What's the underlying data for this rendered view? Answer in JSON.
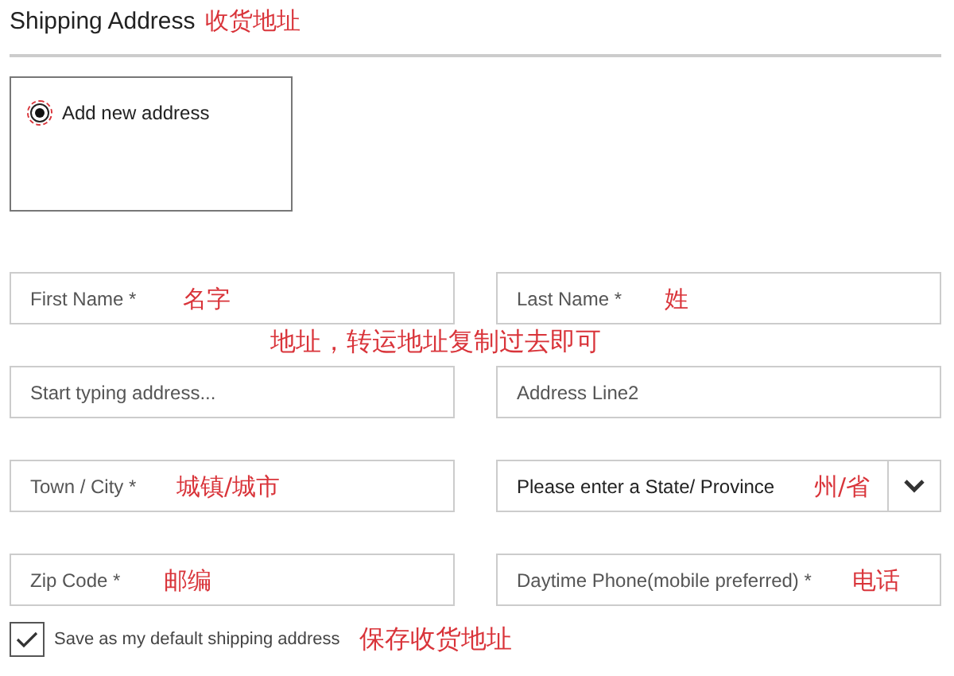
{
  "title": "Shipping Address",
  "title_note": "收货地址",
  "address_option": {
    "label": "Add new address",
    "selected": true
  },
  "fields": [
    {
      "kind": "input",
      "placeholder": "First Name *",
      "note": "名字"
    },
    {
      "kind": "input",
      "placeholder": "Last Name *",
      "note": "姓"
    },
    {
      "kind": "input",
      "placeholder": "Start typing address..."
    },
    {
      "kind": "input",
      "placeholder": "Address Line2"
    },
    {
      "kind": "input",
      "placeholder": "Town / City *",
      "note": "城镇/城市"
    },
    {
      "kind": "select",
      "value": "Please enter a State/ Province",
      "note": "州/省"
    },
    {
      "kind": "input",
      "placeholder": "Zip Code *",
      "note": "邮编"
    },
    {
      "kind": "input",
      "placeholder": "Daytime Phone(mobile preferred) *",
      "note": "电话"
    }
  ],
  "address_note": "地址，转运地址复制过去即可",
  "save_default": {
    "label": "Save as my default shipping address",
    "checked": true,
    "note": "保存收货地址"
  }
}
